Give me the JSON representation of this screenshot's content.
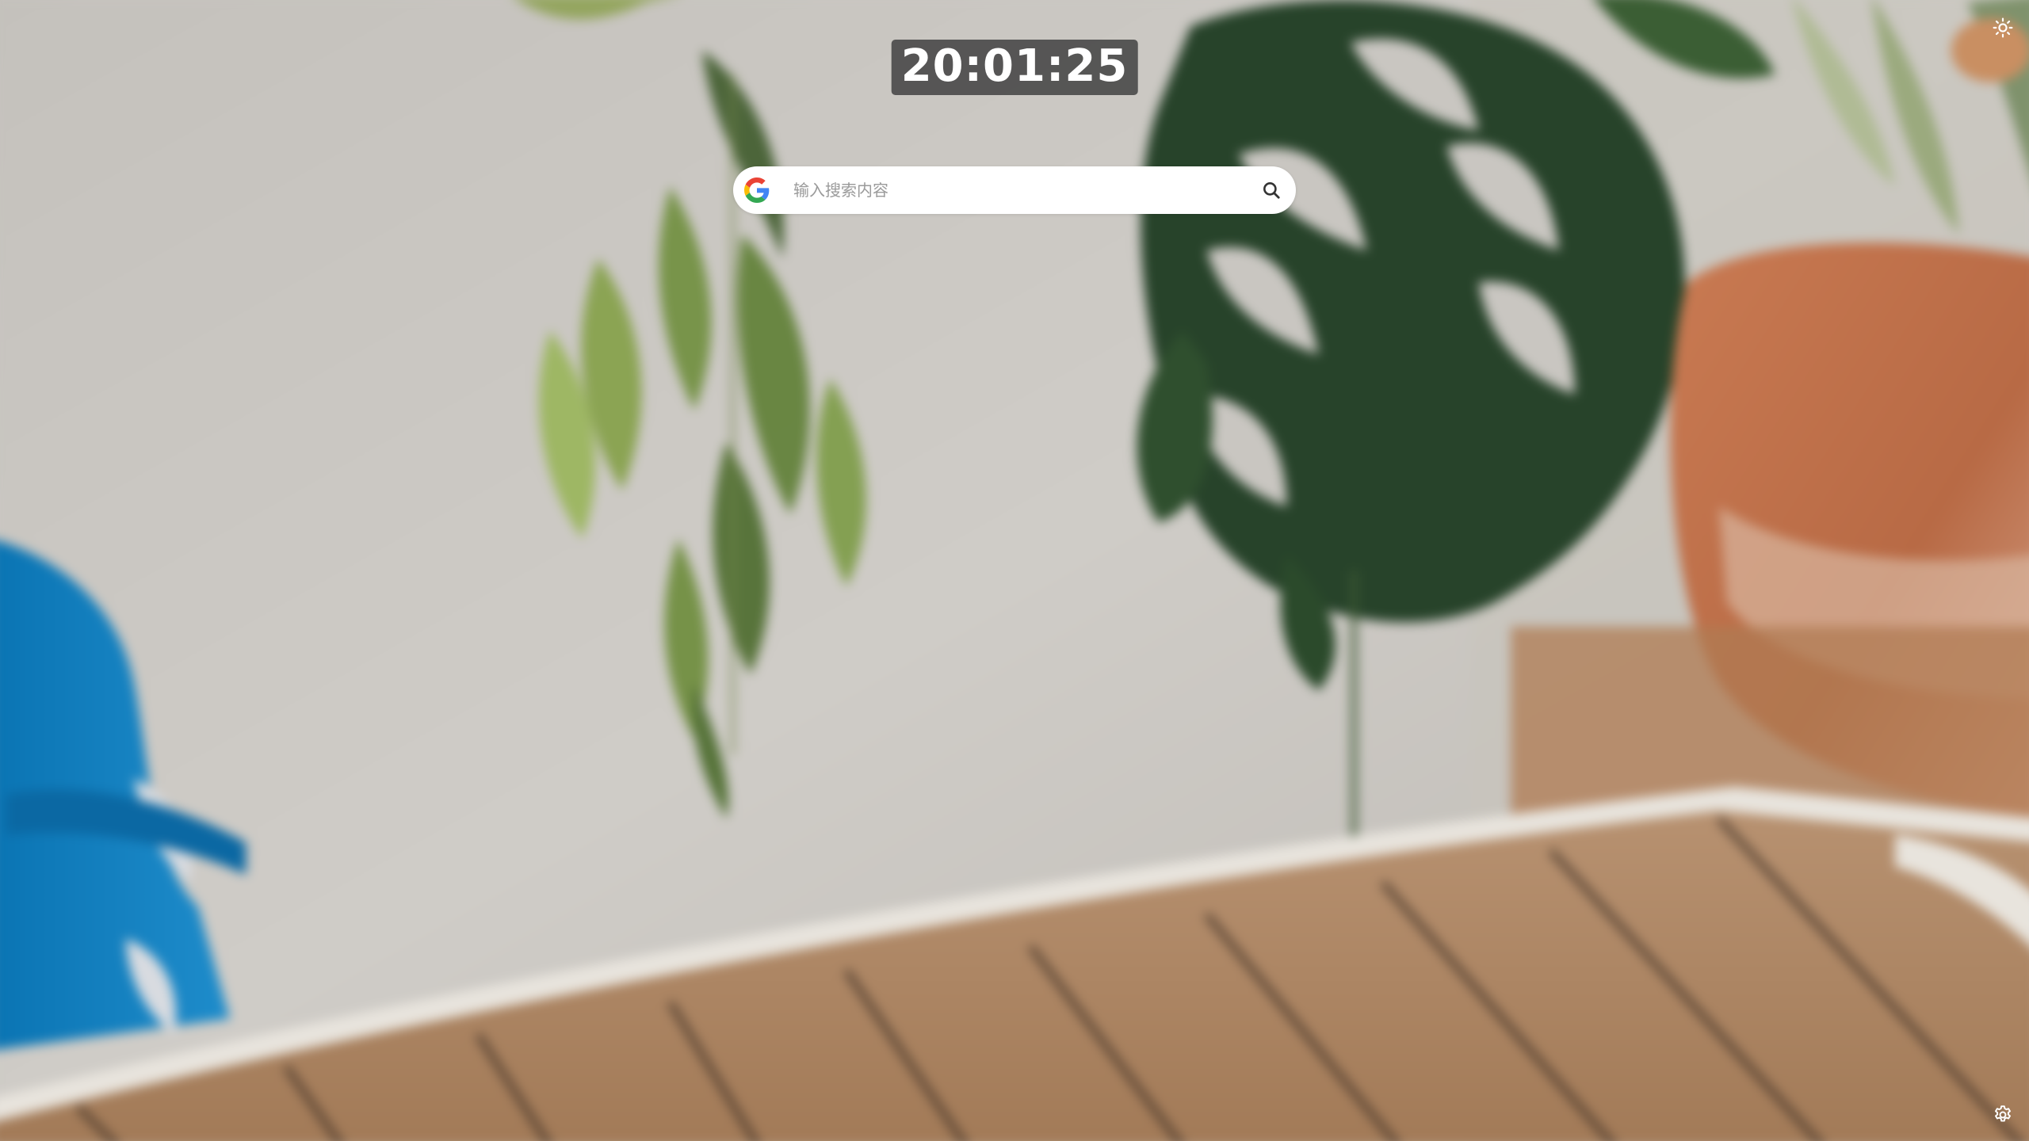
{
  "clock": {
    "time": "20:01:25"
  },
  "search": {
    "engine_icon": "google-g-icon",
    "placeholder": "输入搜索内容",
    "value": "",
    "submit_icon": "search-icon"
  },
  "top_right": {
    "icon": "sun-icon"
  },
  "bottom_right": {
    "icon": "gear-icon"
  },
  "colors": {
    "google_blue": "#4285F4",
    "google_red": "#EA4335",
    "google_yellow": "#FBBC05",
    "google_green": "#34A853",
    "clock_bg": "#464646",
    "icon_white": "#ffffff"
  },
  "background": {
    "description_icon": "wallpaper-photo"
  }
}
